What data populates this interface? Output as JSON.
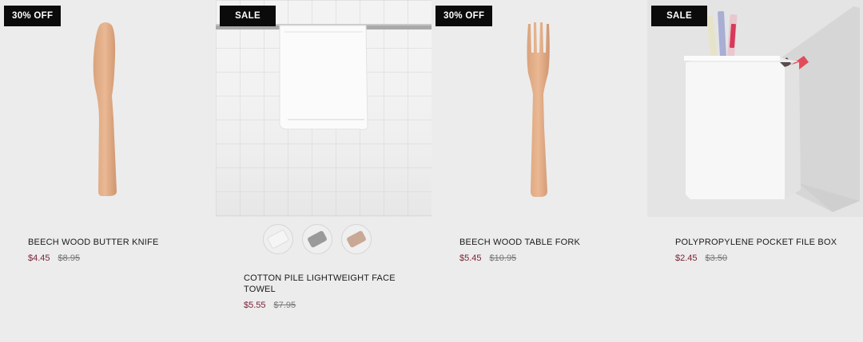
{
  "products": [
    {
      "badge": "30% OFF",
      "title": "BEECH WOOD BUTTER KNIFE",
      "price": "$4.45",
      "old_price": "$8.95",
      "image_icon": "butter-knife-icon"
    },
    {
      "badge": "SALE",
      "title": "COTTON PILE LIGHTWEIGHT FACE TOWEL",
      "price": "$5.55",
      "old_price": "$7.95",
      "image_icon": "face-towel-icon",
      "swatches": [
        {
          "name": "white",
          "color": "#f5f5f5"
        },
        {
          "name": "gray",
          "color": "#9a9a9a"
        },
        {
          "name": "beige",
          "color": "#c9a896"
        }
      ]
    },
    {
      "badge": "30% OFF",
      "title": "BEECH WOOD TABLE FORK",
      "price": "$5.45",
      "old_price": "$10.95",
      "image_icon": "fork-icon"
    },
    {
      "badge": "SALE",
      "title": "POLYPROPYLENE POCKET FILE BOX",
      "price": "$2.45",
      "old_price": "$3.50",
      "image_icon": "file-box-icon"
    }
  ],
  "colors": {
    "price": "#7a1f33",
    "badge_bg": "#0b0b0b",
    "page_bg": "#ececec"
  }
}
